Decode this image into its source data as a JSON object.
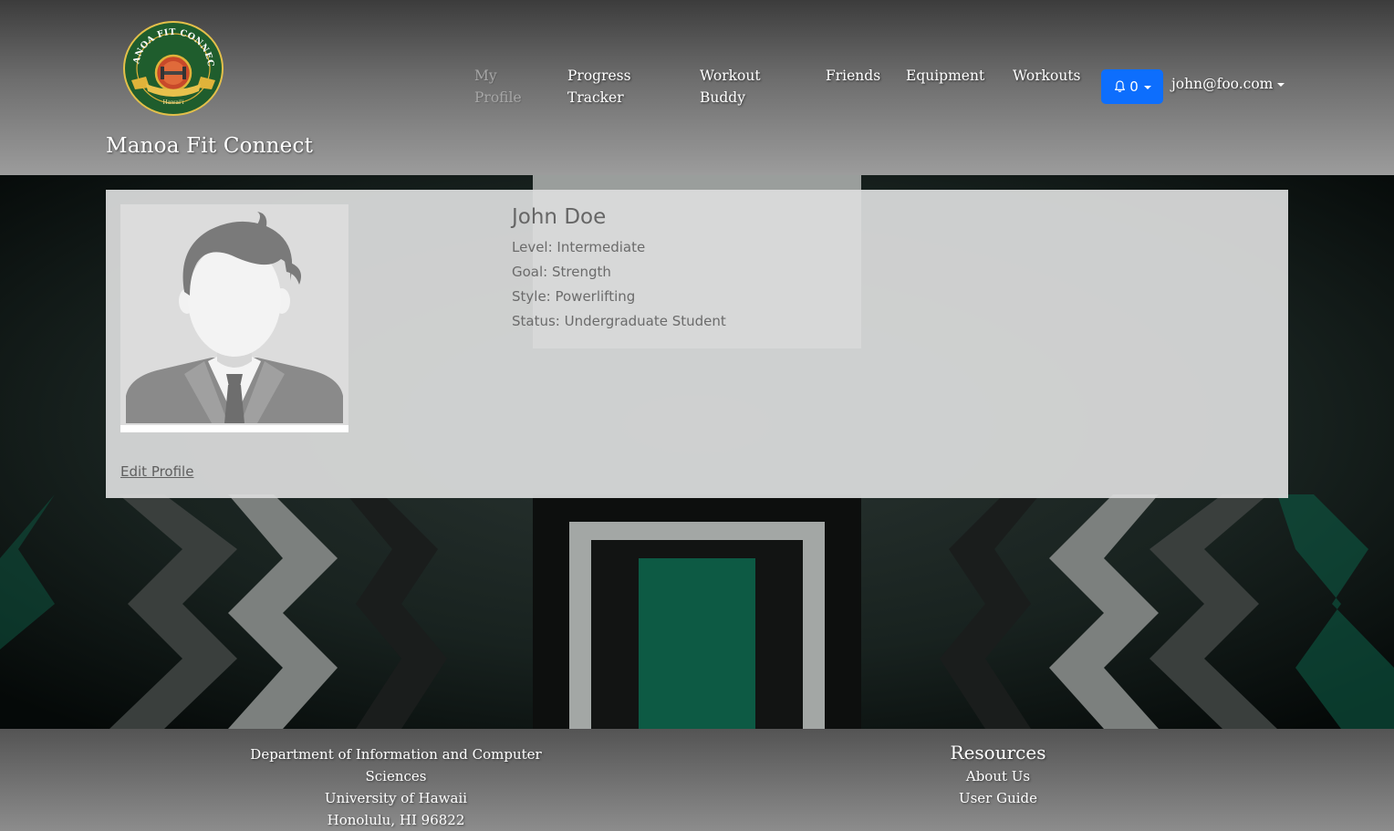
{
  "brand": {
    "name": "Manoa Fit Connect",
    "logo_text": "MANOA FIT CONNECT",
    "logo_sub": "Hawai'i"
  },
  "nav": {
    "items": [
      {
        "label_1": "My",
        "label_2": "Profile",
        "active": true
      },
      {
        "label_1": "Progress",
        "label_2": "Tracker",
        "active": false
      },
      {
        "label_1": "Workout",
        "label_2": "Buddy",
        "active": false
      },
      {
        "label_1": "Friends",
        "label_2": "",
        "active": false
      },
      {
        "label_1": "Equipment",
        "label_2": "",
        "active": false
      },
      {
        "label_1": "Workouts",
        "label_2": "",
        "active": false
      }
    ],
    "notifications": {
      "icon": "bell-icon",
      "count": "0",
      "color": "#0d6efd"
    },
    "user_email": "john@foo.com"
  },
  "profile": {
    "name": "John Doe",
    "level": "Level: Intermediate",
    "goal": "Goal: Strength",
    "style": "Style: Powerlifting",
    "status": "Status: Undergraduate Student",
    "edit_label": "Edit Profile"
  },
  "footer": {
    "dept": "Department of Information and Computer Sciences",
    "university": "University of Hawaii",
    "address": "Honolulu, HI 96822",
    "resources_heading": "Resources",
    "links": [
      "About Us",
      "User Guide"
    ]
  },
  "colors": {
    "accent": "#0d6efd",
    "hero_green": "#0d5a44",
    "logo_green": "#1f5d2d",
    "logo_gold": "#e0b33a"
  }
}
